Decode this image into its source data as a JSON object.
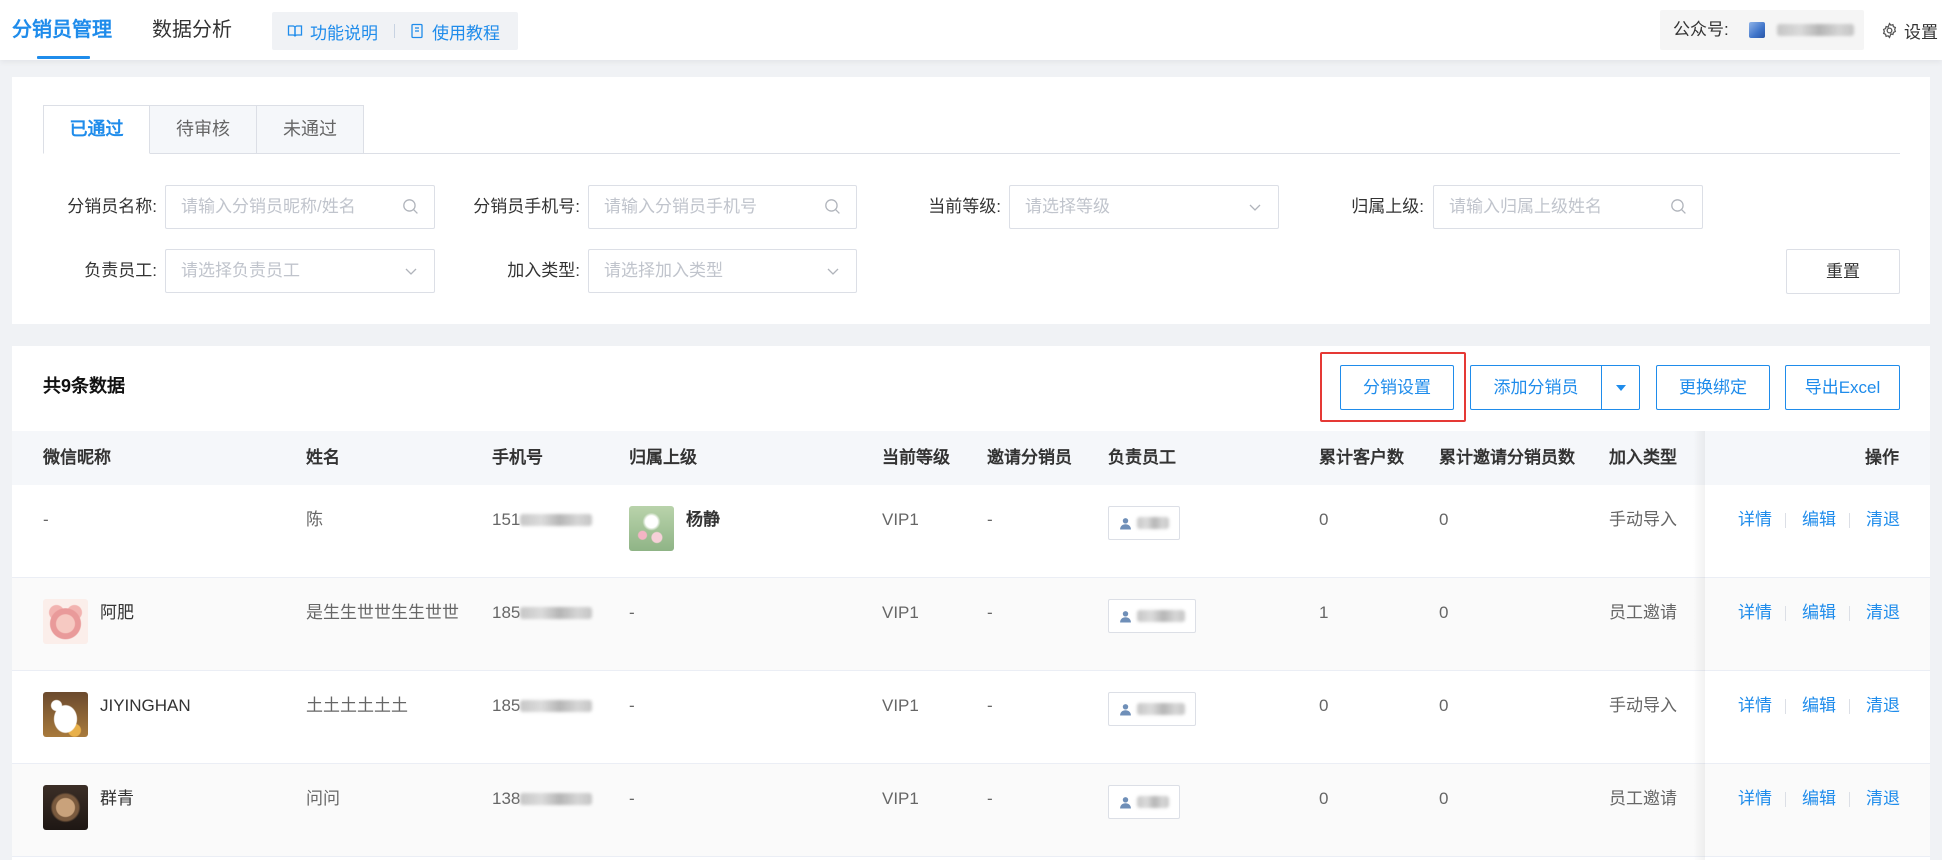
{
  "header": {
    "tabs": [
      {
        "label": "分销员管理",
        "active": true
      },
      {
        "label": "数据分析",
        "active": false
      }
    ],
    "help_links": [
      {
        "label": "功能说明",
        "icon": "book-icon"
      },
      {
        "label": "使用教程",
        "icon": "document-icon"
      }
    ],
    "account_label": "公众号:",
    "account_icon": "account-avatar-icon",
    "settings_label": "设置",
    "settings_icon": "gear-icon"
  },
  "status_tabs": [
    {
      "label": "已通过",
      "active": true
    },
    {
      "label": "待审核",
      "active": false
    },
    {
      "label": "未通过",
      "active": false
    }
  ],
  "filters": {
    "name": {
      "label": "分销员名称:",
      "placeholder": "请输入分销员昵称/姓名"
    },
    "phone": {
      "label": "分销员手机号:",
      "placeholder": "请输入分销员手机号"
    },
    "level": {
      "label": "当前等级:",
      "placeholder": "请选择等级"
    },
    "parent": {
      "label": "归属上级:",
      "placeholder": "请输入归属上级姓名"
    },
    "staff": {
      "label": "负责员工:",
      "placeholder": "请选择负责员工"
    },
    "join_type": {
      "label": "加入类型:",
      "placeholder": "请选择加入类型"
    },
    "reset_label": "重置"
  },
  "toolbar": {
    "total_text": "共9条数据",
    "distribution_settings_label": "分销设置",
    "add_distributor_label": "添加分销员",
    "change_binding_label": "更换绑定",
    "export_excel_label": "导出Excel"
  },
  "table": {
    "columns": [
      "微信昵称",
      "姓名",
      "手机号",
      "归属上级",
      "当前等级",
      "邀请分销员",
      "负责员工",
      "累计客户数",
      "累计邀请分销员数",
      "加入类型",
      "操作"
    ],
    "actions": [
      "详情",
      "编辑",
      "清退"
    ],
    "rows": [
      {
        "nickname": "-",
        "nickname_avatar": null,
        "name": "陈",
        "phone": "151",
        "parent": "杨静",
        "parent_avatar": "green-photo-avatar",
        "level": "VIP1",
        "inviter": "-",
        "customer_count": 0,
        "invite_count": 0,
        "join_type": "手动导入"
      },
      {
        "nickname": "阿肥",
        "nickname_avatar": "pink-cartoon-avatar",
        "name": "是生生世世生生世世",
        "phone": "185",
        "parent": "-",
        "parent_avatar": null,
        "level": "VIP1",
        "inviter": "-",
        "customer_count": 1,
        "invite_count": 0,
        "join_type": "员工邀请"
      },
      {
        "nickname": "JIYINGHAN",
        "nickname_avatar": "cat-cartoon-avatar",
        "name": "土土土土土土",
        "phone": "185",
        "parent": "-",
        "parent_avatar": null,
        "level": "VIP1",
        "inviter": "-",
        "customer_count": 0,
        "invite_count": 0,
        "join_type": "手动导入"
      },
      {
        "nickname": "群青",
        "nickname_avatar": "dark-photo-avatar",
        "name": "问问",
        "phone": "138",
        "parent": "-",
        "parent_avatar": null,
        "level": "VIP1",
        "inviter": "-",
        "customer_count": 0,
        "invite_count": 0,
        "join_type": "员工邀请"
      }
    ]
  },
  "colors": {
    "primary": "#1f8ceb",
    "highlight": "#e53935",
    "page_bg": "#f0f2f5",
    "header_bg": "#f5f7fa",
    "stripe_bg": "#fafafa"
  }
}
